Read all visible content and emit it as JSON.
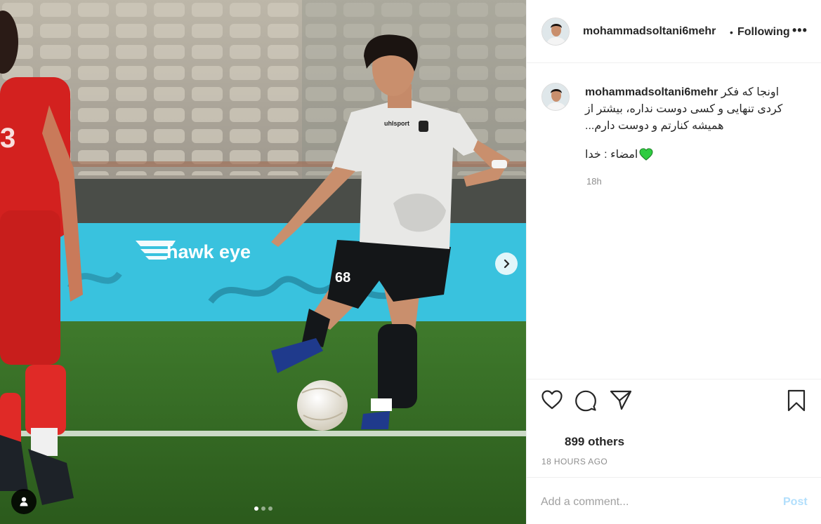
{
  "post": {
    "username": "mohammadsoltani6mehr",
    "separator": "•",
    "follow_status": "Following",
    "more": "•••"
  },
  "caption": {
    "username": "mohammadsoltani6mehr",
    "line1": "اونجا که فکر",
    "line2": "کردی تنهایی و کسی دوست نداره، بیشتر از",
    "line3": "همیشه کنارتم و دوست دارم...",
    "signature": "امضاء : خدا",
    "time": "18h"
  },
  "media": {
    "board_brand": "hawk eye",
    "jersey_brand": "uhlsport",
    "shirt_number": "68",
    "carousel": {
      "count": 3,
      "active": 0
    }
  },
  "engagement": {
    "likes": "899 others",
    "timestamp": "18 HOURS AGO"
  },
  "comment_box": {
    "placeholder": "Add a comment...",
    "post_label": "Post"
  },
  "colors": {
    "text": "#262626",
    "muted": "#8e8e8e",
    "post_disabled": "#b2dffc",
    "heart": "#2ecc40",
    "border": "#efefef"
  },
  "icons": {
    "like": "heart-icon",
    "comment": "comment-icon",
    "share": "paper-plane-icon",
    "save": "bookmark-icon",
    "next": "chevron-right-icon",
    "tag": "user-tag-icon"
  }
}
